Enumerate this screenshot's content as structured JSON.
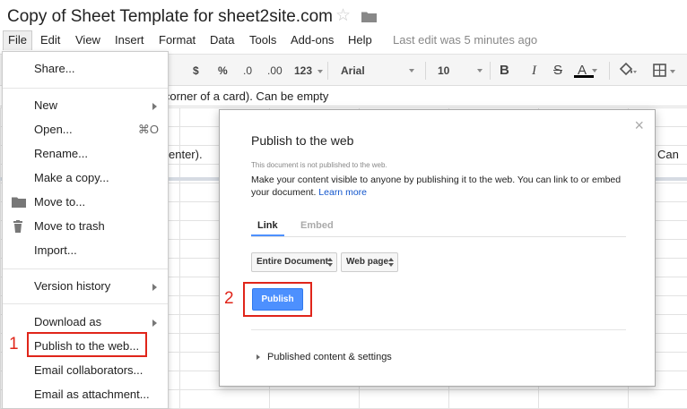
{
  "app": {
    "doc_title": "Copy of Sheet Template for sheet2site.com",
    "last_edit": "Last edit was 5 minutes ago"
  },
  "menubar": {
    "items": [
      {
        "name": "menu-file",
        "label": "File"
      },
      {
        "name": "menu-edit",
        "label": "Edit"
      },
      {
        "name": "menu-view",
        "label": "View"
      },
      {
        "name": "menu-insert",
        "label": "Insert"
      },
      {
        "name": "menu-format",
        "label": "Format"
      },
      {
        "name": "menu-data",
        "label": "Data"
      },
      {
        "name": "menu-tools",
        "label": "Tools"
      },
      {
        "name": "menu-addons",
        "label": "Add-ons"
      },
      {
        "name": "menu-help",
        "label": "Help"
      }
    ]
  },
  "toolbar": {
    "currency": "$",
    "percent": "%",
    "decrease_decimal": ".0",
    "increase_decimal": ".00",
    "more_formats": "123",
    "font": "Arial",
    "font_size": "10",
    "bold": "B",
    "italic": "I",
    "strikethrough": "S",
    "text_color": "A"
  },
  "sheet": {
    "formula_text": "ft corner of a card). Can be empty",
    "cell_center": "enter).",
    "cell_right": "Can"
  },
  "file_menu": {
    "items": [
      {
        "label": "Share..."
      },
      {
        "label": "New"
      },
      {
        "label": "Open...",
        "shortcut": "⌘O"
      },
      {
        "label": "Rename..."
      },
      {
        "label": "Make a copy..."
      },
      {
        "label": "Move to..."
      },
      {
        "label": "Move to trash"
      },
      {
        "label": "Import..."
      },
      {
        "label": "Version history"
      },
      {
        "label": "Download as"
      },
      {
        "label": "Publish to the web..."
      },
      {
        "label": "Email collaborators..."
      },
      {
        "label": "Email as attachment..."
      }
    ]
  },
  "steps": {
    "one": "1",
    "two": "2"
  },
  "dialog": {
    "close": "×",
    "title": "Publish to the web",
    "status": "This document is not published to the web.",
    "description": "Make your content visible to anyone by publishing it to the web. You can link to or embed your document.",
    "learn_more": "Learn more",
    "tabs": [
      "Link",
      "Embed"
    ],
    "select_scope": "Entire Document",
    "select_format": "Web page",
    "publish_button": "Publish",
    "settings_label": "Published content & settings"
  },
  "colors": {
    "accent_blue": "#4d90fe",
    "highlight_red": "#e0251a"
  }
}
